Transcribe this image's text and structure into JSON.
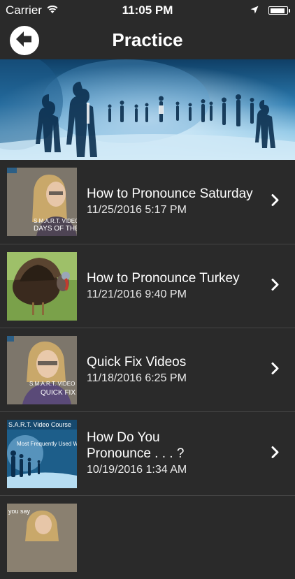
{
  "status_bar": {
    "carrier": "Carrier",
    "time": "11:05 PM"
  },
  "nav": {
    "title": "Practice"
  },
  "items": [
    {
      "title": "How to Pronounce Saturday",
      "date": "11/25/2016 5:17 PM",
      "thumb_caption_1": "S.M.A.R.T. VIDEO C",
      "thumb_caption_2": "DAYS OF THE"
    },
    {
      "title": "How to Pronounce Turkey",
      "date": "11/21/2016 9:40 PM"
    },
    {
      "title": "Quick Fix Videos",
      "date": "11/18/2016 6:25 PM",
      "thumb_caption_1": "S.M.A.R.T. VIDEO C",
      "thumb_caption_2": "QUICK FIX"
    },
    {
      "title": "How Do You Pronounce . . . ?",
      "date": "10/19/2016 1:34 AM",
      "thumb_caption_1": "S.A.R.T. Video Course",
      "thumb_caption_2": "Most Frequently Used Wo"
    },
    {
      "thumb_caption_1": "you say"
    }
  ],
  "colors": {
    "background": "#2a2a2a",
    "divider": "#444444",
    "text": "#ffffff"
  },
  "icons": {
    "back": "back-arrow-icon",
    "chevron": "chevron-right-icon",
    "wifi": "wifi-icon",
    "location": "location-arrow-icon",
    "battery": "battery-icon"
  },
  "battery_level": 0.95
}
